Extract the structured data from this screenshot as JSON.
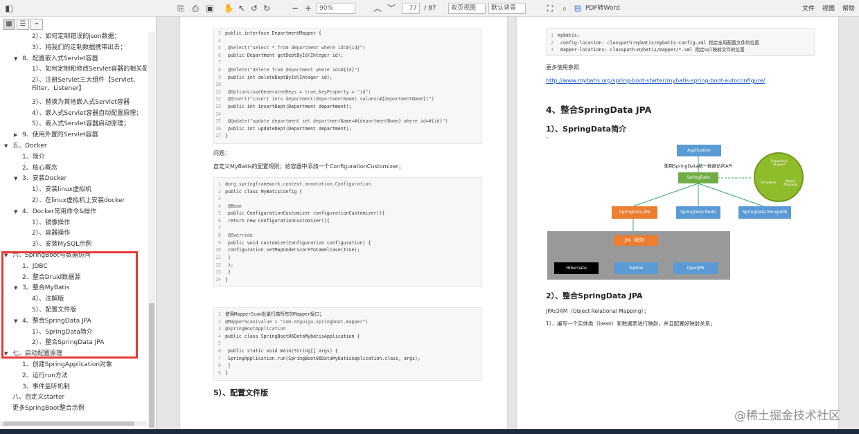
{
  "toolbar": {
    "zoom": "90%",
    "page_current": "77",
    "page_total": "/ 87",
    "view_mode": "双页视图",
    "background": "默认背景",
    "pdf_to_word": "PDF转Word",
    "menu_file": "文件",
    "menu_view": "视图",
    "menu_help": "帮助"
  },
  "tree": [
    {
      "label": "2）、如何定制错误的json数据；",
      "level": 3
    },
    {
      "label": "3）、将我们的定制数据携带出去；",
      "level": 3
    },
    {
      "label": "8、配置嵌入式Servlet容器",
      "level": 2,
      "caret": "▼"
    },
    {
      "label": "1）、如何定制和修改Servlet容器的相关配置；",
      "level": 3
    },
    {
      "label": "2）、注册Servlet三大组件【Servlet、Filter、Listener】",
      "level": 3,
      "lines": 2
    },
    {
      "label": "3）、替换为其他嵌入式Servlet容器",
      "level": 3
    },
    {
      "label": "4）、嵌入式Servlet容器自动配置原理；",
      "level": 3
    },
    {
      "label": "5）、嵌入式Servlet容器启动原理；",
      "level": 3
    },
    {
      "label": "9、使用外置的Servlet容器",
      "level": 2,
      "caret": "▶"
    },
    {
      "label": "五、Docker",
      "level": 1,
      "caret": "▼"
    },
    {
      "label": "1、简介",
      "level": 2
    },
    {
      "label": "2、核心概念",
      "level": 2
    },
    {
      "label": "3、安装Docker",
      "level": 2,
      "caret": "▼"
    },
    {
      "label": "1）、安装linux虚拟机",
      "level": 3
    },
    {
      "label": "2）、在linux虚拟机上安装docker",
      "level": 3
    },
    {
      "label": "4、Docker常用命令&操作",
      "level": 2,
      "caret": "▼"
    },
    {
      "label": "1）、镜像操作",
      "level": 3
    },
    {
      "label": "2）、容器操作",
      "level": 3
    },
    {
      "label": "3）、安装MySQL示例",
      "level": 3
    },
    {
      "label": "六、SpringBoot与数据访问",
      "level": 1,
      "caret": "▼"
    },
    {
      "label": "1、JDBC",
      "level": 2
    },
    {
      "label": "2、整合Druid数据源",
      "level": 2
    },
    {
      "label": "3、整合MyBatis",
      "level": 2,
      "caret": "▼"
    },
    {
      "label": "4）、注解版",
      "level": 3
    },
    {
      "label": "5）、配置文件版",
      "level": 3
    },
    {
      "label": "4、整合SpringData JPA",
      "level": 2,
      "caret": "▼"
    },
    {
      "label": "1）、SpringData简介",
      "level": 3
    },
    {
      "label": "2）、整合SpringData JPA",
      "level": 3
    },
    {
      "label": "七、启动配置原理",
      "level": 1,
      "caret": "▼"
    },
    {
      "label": "1、创建SpringApplication对象",
      "level": 2
    },
    {
      "label": "2、运行run方法",
      "level": 2
    },
    {
      "label": "3、事件监听机制",
      "level": 2
    },
    {
      "label": "八、自定义starter",
      "level": 1
    },
    {
      "label": "更多SpringBoot整合示例",
      "level": 1
    }
  ],
  "left_page": {
    "code1": [
      {
        "n": "3",
        "t": "public interface DepartmentMapper {"
      },
      {
        "n": "4",
        "t": ""
      },
      {
        "n": "5",
        "t": "    @Select(\"select * from department where id=#{id}\")"
      },
      {
        "n": "6",
        "t": "    public Department getDeptById(Integer id);"
      },
      {
        "n": "7",
        "t": ""
      },
      {
        "n": "8",
        "t": "    @Delete(\"delete from department where id=#{id}\")"
      },
      {
        "n": "9",
        "t": "    public int deleteDeptById(Integer id);"
      },
      {
        "n": "10",
        "t": ""
      },
      {
        "n": "11",
        "t": "    @Options(useGeneratedKeys = true,keyProperty = \"id\")"
      },
      {
        "n": "12",
        "t": "    @Insert(\"insert into department(departmentName) values(#{departmentName})\")"
      },
      {
        "n": "13",
        "t": "    public int insertDept(Department department);"
      },
      {
        "n": "14",
        "t": ""
      },
      {
        "n": "15",
        "t": "    @Update(\"update department set departmentName=#{departmentName} where id=#{id}\")"
      },
      {
        "n": "16",
        "t": "    public int updateDept(Department department);"
      },
      {
        "n": "17",
        "t": "}"
      }
    ],
    "question": "问题：",
    "question_text": "自定义MyBatis的配置规则；给容器中添加一个ConfigurationCustomizer；",
    "code2": [
      {
        "n": "1",
        "t": "@org.springframework.context.annotation.Configuration"
      },
      {
        "n": "2",
        "t": "public class MyBatisConfig {"
      },
      {
        "n": "3",
        "t": ""
      },
      {
        "n": "4",
        "t": "    @Bean"
      },
      {
        "n": "5",
        "t": "    public ConfigurationCustomizer configurationCustomizer(){"
      },
      {
        "n": "6",
        "t": "        return new ConfigurationCustomizer(){"
      },
      {
        "n": "7",
        "t": ""
      },
      {
        "n": "8",
        "t": "            @Override"
      },
      {
        "n": "9",
        "t": "            public void customize(Configuration configuration) {"
      },
      {
        "n": "10",
        "t": "                configuration.setMapUnderscoreToCamelCase(true);"
      },
      {
        "n": "11",
        "t": "            }"
      },
      {
        "n": "12",
        "t": "        };"
      },
      {
        "n": "13",
        "t": "    }"
      },
      {
        "n": "14",
        "t": "}"
      }
    ],
    "code3": [
      {
        "n": "1",
        "t": "使用MapperScan批量扫描所有的Mapper接口；"
      },
      {
        "n": "2",
        "t": "@MapperScan(value = \"com.atguigu.springboot.mapper\")"
      },
      {
        "n": "3",
        "t": "@SpringBootApplication"
      },
      {
        "n": "4",
        "t": "public class SpringBoot06DataMybatisApplication {"
      },
      {
        "n": "5",
        "t": ""
      },
      {
        "n": "6",
        "t": "    public static void main(String[] args) {"
      },
      {
        "n": "7",
        "t": "        SpringApplication.run(SpringBoot06DataMybatisApplication.class, args);"
      },
      {
        "n": "8",
        "t": "    }"
      },
      {
        "n": "9",
        "t": "}"
      }
    ],
    "heading_config": "5）、配置文件版"
  },
  "right_page": {
    "code_yaml": [
      {
        "n": "1",
        "t": "mybatis:"
      },
      {
        "n": "2",
        "t": "  config-location: classpath:mybatis/mybatis-config.xml 指定全局配置文件的位置"
      },
      {
        "n": "3",
        "t": "  mapper-locations: classpath:mybatis/mapper/*.xml  指定sql映射文件的位置"
      }
    ],
    "more_ref": "更多使用参照",
    "link": "http://www.mybatis.org/spring-boot-starter/mybatis-spring-boot-autoconfigure/",
    "h_jpa": "4、整合SpringData JPA",
    "h_intro": "1）、SpringData简介",
    "h_integrate": "2）、整合SpringData JPA",
    "orm_text": "JPA:ORM（Object Relational Mapping）；",
    "step1": "1）、编写一个实体类（bean）和数据表进行映射，并且配置好映射关系；",
    "diagram": {
      "application": "Application",
      "unified_api": "使用SpringData统一数据访问API",
      "springdata": "SpringData",
      "sd_jpa": "SpringData JPA",
      "sd_redis": "SpringData Redis",
      "sd_mongo": "SpringData MongoDB",
      "jpa_spec": "JPA（规范）",
      "hibernate": "Hibernate",
      "toplink": "Toplink",
      "openjpa": "OpenJPA",
      "circle_repo": "Repository Support",
      "circle_tpl": "Templates",
      "circle_obj": "Object Mapping"
    }
  },
  "watermark": "@稀土掘金技术社区"
}
